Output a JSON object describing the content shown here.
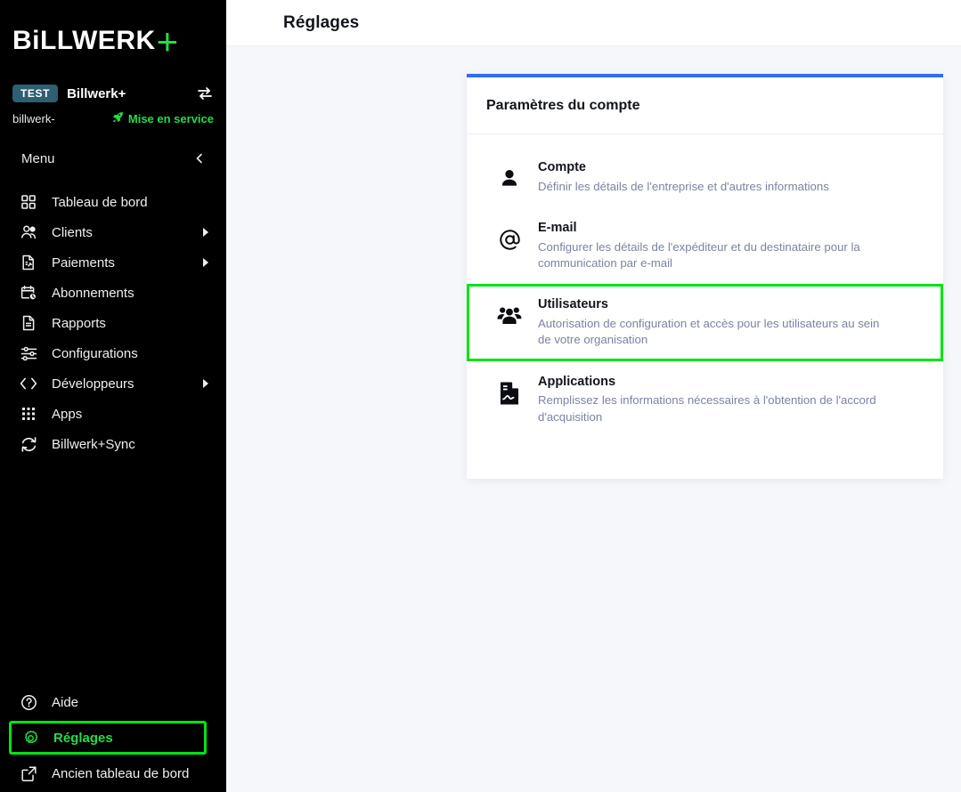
{
  "brand": {
    "logo_text": "BiLLWERK",
    "logo_plus": "+",
    "accent_green": "#22dd44",
    "background": "#000000"
  },
  "account": {
    "badge": "TEST",
    "badge_color": "#2e5f73",
    "name": "Billwerk+",
    "handle": "billwerk-",
    "status": "Mise en service",
    "status_icon": "rocket-icon",
    "switch_icon": "switch-accounts-icon"
  },
  "sidebar": {
    "menu_label": "Menu",
    "collapse_icon": "chevron-left-icon",
    "items": [
      {
        "label": "Tableau de bord",
        "icon": "dashboard-grid-icon",
        "has_submenu": false
      },
      {
        "label": "Clients",
        "icon": "users-icon",
        "has_submenu": true
      },
      {
        "label": "Paiements",
        "icon": "invoice-document-icon",
        "has_submenu": true
      },
      {
        "label": "Abonnements",
        "icon": "calendar-clock-icon",
        "has_submenu": false
      },
      {
        "label": "Rapports",
        "icon": "report-document-icon",
        "has_submenu": false
      },
      {
        "label": "Configurations",
        "icon": "sliders-icon",
        "has_submenu": false
      },
      {
        "label": "Développeurs",
        "icon": "code-brackets-icon",
        "has_submenu": true
      },
      {
        "label": "Apps",
        "icon": "apps-dots-icon",
        "has_submenu": false
      },
      {
        "label": "Billwerk+Sync",
        "icon": "sync-refresh-icon",
        "has_submenu": false
      }
    ],
    "bottom_items": [
      {
        "label": "Aide",
        "icon": "help-circle-icon",
        "highlighted": false
      },
      {
        "label": "Réglages",
        "icon": "gear-icon",
        "highlighted": true
      },
      {
        "label": "Ancien tableau de bord",
        "icon": "external-link-icon",
        "highlighted": false
      }
    ],
    "highlight_color": "#00e314"
  },
  "header": {
    "title": "Réglages"
  },
  "card": {
    "title": "Paramètres du compte",
    "accent_color": "#2f6df6",
    "rows": [
      {
        "title": "Compte",
        "desc": "Définir les détails de l'entreprise et d'autres informations",
        "icon": "person-icon",
        "selected": false
      },
      {
        "title": "E-mail",
        "desc": "Configurer les détails de l'expéditeur et du destinataire pour la communication par e-mail",
        "icon": "at-sign-icon",
        "selected": false
      },
      {
        "title": "Utilisateurs",
        "desc": "Autorisation de configuration et accès pour les utilisateurs au sein de votre organisation",
        "icon": "group-users-icon",
        "selected": true
      },
      {
        "title": "Applications",
        "desc": "Remplissez les informations nécessaires à l'obtention de l'accord d'acquisition",
        "icon": "signed-document-icon",
        "selected": false
      }
    ]
  }
}
